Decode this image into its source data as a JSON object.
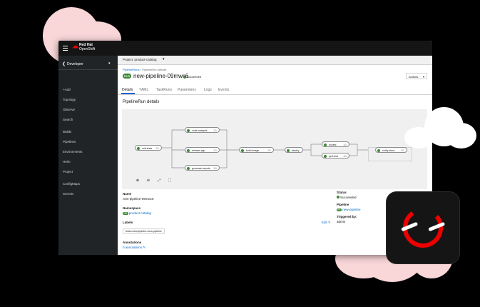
{
  "brand": {
    "line1": "Red Hat",
    "line2": "OpenShift"
  },
  "perspective": {
    "label": "Developer"
  },
  "nav": [
    "+Add",
    "Topology",
    "Observe",
    "Search",
    "Builds",
    "Pipelines",
    "Environments",
    "Helm",
    "Project",
    "ConfigMaps",
    "Secrets"
  ],
  "project_bar": {
    "label": "Project: product-catalog"
  },
  "breadcrumb": {
    "parent": "PipelineRuns",
    "current": "PipelineRun details"
  },
  "header": {
    "badge": "PLR",
    "title": "new-pipeline-09mwc6",
    "status": "Succeeded",
    "actions": "Actions"
  },
  "tabs": [
    "Details",
    "YAML",
    "TaskRuns",
    "Parameters",
    "Logs",
    "Events"
  ],
  "section_title": "PipelineRun details",
  "graph_nodes": [
    {
      "name": "unit-tests",
      "dur": "1/1"
    },
    {
      "name": "code-analysis",
      "dur": "1/1"
    },
    {
      "name": "release-app",
      "dur": "1/1"
    },
    {
      "name": "generate-reports",
      "dur": "1/1"
    },
    {
      "name": "build-image",
      "dur": "1/1"
    },
    {
      "name": "deploy",
      "dur": "1/1"
    },
    {
      "name": "int-test",
      "dur": "1/1"
    },
    {
      "name": "perf-test",
      "dur": "1/1"
    },
    {
      "name": "notify-slack",
      "dur": "1/1"
    }
  ],
  "graph_controls": [
    "zoom-in",
    "zoom-out",
    "fit-to-screen",
    "expand"
  ],
  "details": {
    "name_label": "Name",
    "name_value": "new-pipeline-09mwc6",
    "namespace_label": "Namespace",
    "namespace_badge": "NS",
    "namespace_value": "product-catalog",
    "labels_label": "Labels",
    "labels_edit": "Edit",
    "label_chip": "tekton.dev/pipeline=new-pipeline",
    "annotations_label": "Annotations",
    "annotations_value": "0 annotations",
    "status_label": "Status",
    "status_value": "Succeeded",
    "pipeline_label": "Pipeline",
    "pipeline_badge": "PL",
    "pipeline_value": "new-pipeline",
    "triggered_label": "Triggered by:",
    "triggered_value": "admin"
  },
  "colors": {
    "accent": "#0066cc",
    "success": "#3e8635",
    "brand_red": "#ee0000",
    "cloud": "#f9d6d8"
  }
}
